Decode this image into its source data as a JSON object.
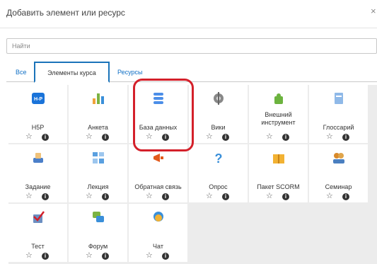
{
  "dialog": {
    "title": "Добавить элемент или ресурс",
    "close_glyph": "×"
  },
  "search": {
    "placeholder": "Найти"
  },
  "tabs": [
    {
      "label": "Все"
    },
    {
      "label": "Элементы курса",
      "active": true
    },
    {
      "label": "Ресурсы"
    }
  ],
  "items": [
    {
      "label": "H5P",
      "icon": "h5p-icon"
    },
    {
      "label": "Анкета",
      "icon": "survey-chart-icon"
    },
    {
      "label": "База данных",
      "icon": "database-icon",
      "highlighted": true
    },
    {
      "label": "Вики",
      "icon": "wiki-icon"
    },
    {
      "label": "Внешний инструмент",
      "icon": "puzzle-icon"
    },
    {
      "label": "Глоссарий",
      "icon": "glossary-icon"
    },
    {
      "label": "Задание",
      "icon": "assignment-icon"
    },
    {
      "label": "Лекция",
      "icon": "lesson-icon"
    },
    {
      "label": "Обратная связь",
      "icon": "megaphone-icon"
    },
    {
      "label": "Опрос",
      "icon": "question-icon"
    },
    {
      "label": "Пакет SCORM",
      "icon": "package-icon"
    },
    {
      "label": "Семинар",
      "icon": "workshop-icon"
    },
    {
      "label": "Тест",
      "icon": "quiz-check-icon"
    },
    {
      "label": "Форум",
      "icon": "forum-icon"
    },
    {
      "label": "Чат",
      "icon": "chat-icon"
    }
  ],
  "item_actions": {
    "star_glyph": "☆",
    "info_glyph": "i"
  },
  "colors": {
    "accent": "#0f6fc5",
    "highlight": "#d4202a",
    "grid_bg": "#ececec"
  }
}
